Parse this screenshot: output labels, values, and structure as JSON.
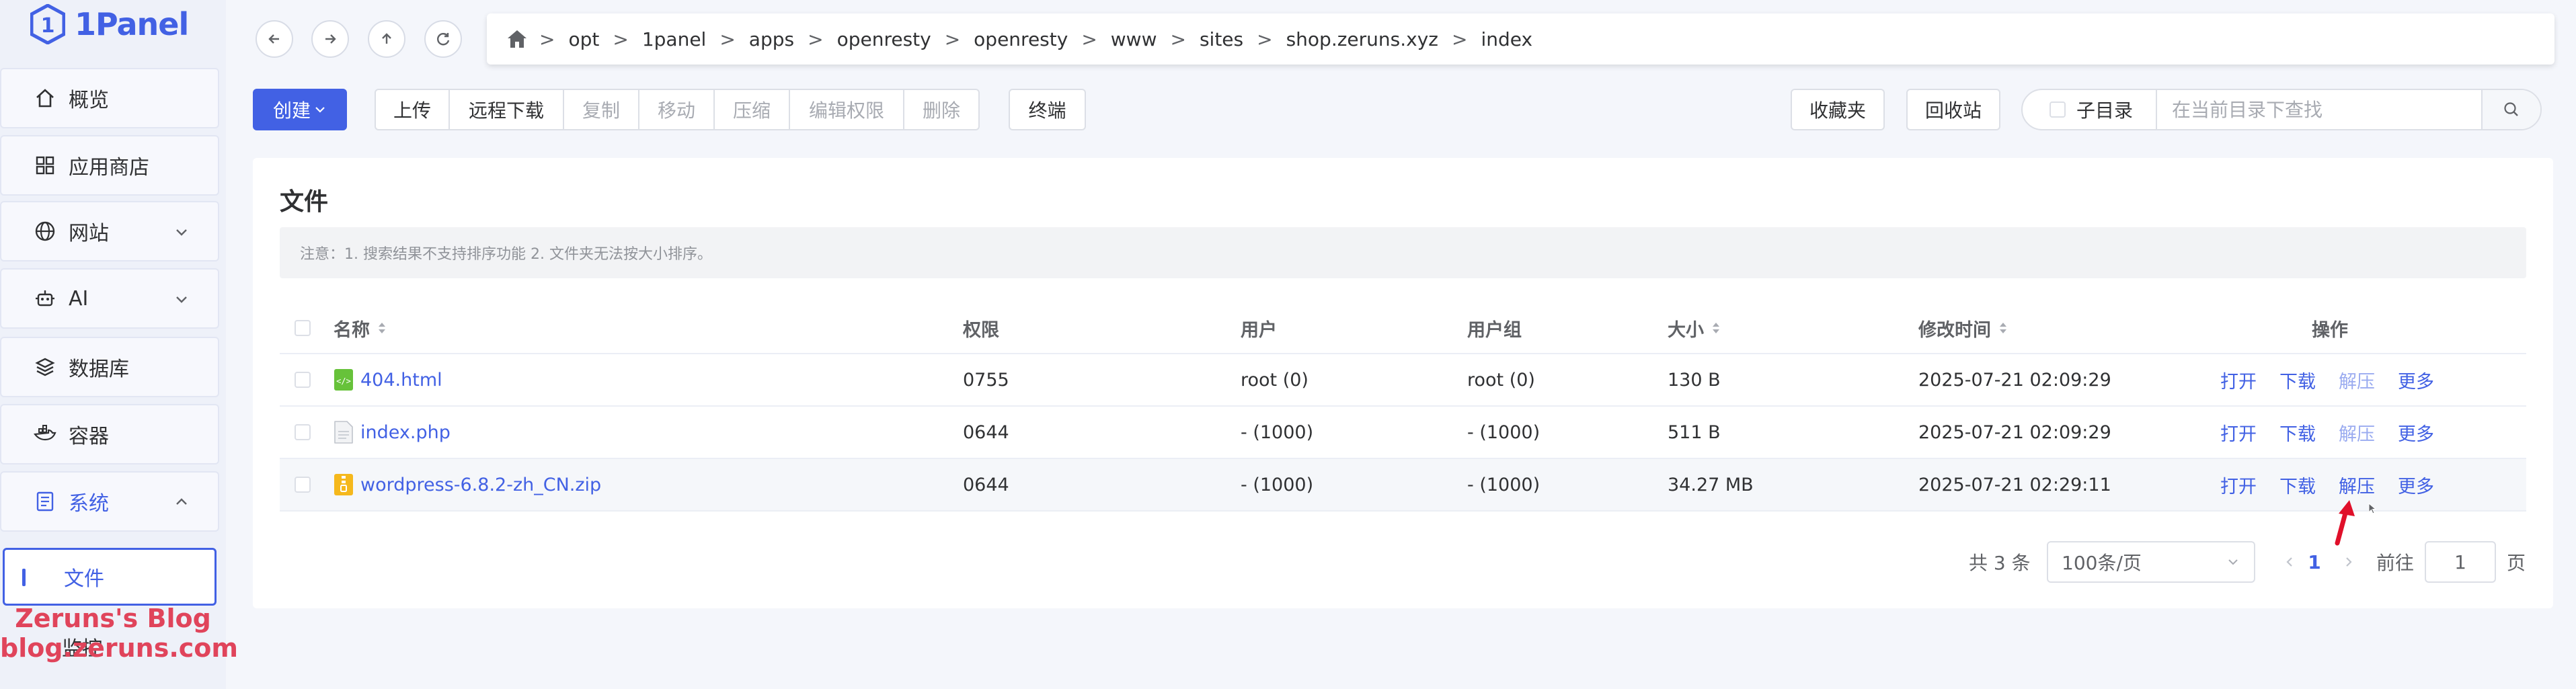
{
  "app": {
    "logo_text": "1Panel",
    "watermark_line1": "Zeruns's Blog",
    "watermark_line2": "blog.zeruns.com"
  },
  "sidebar": {
    "items": [
      {
        "label": "概览",
        "icon": "home-icon"
      },
      {
        "label": "应用商店",
        "icon": "grid-icon"
      },
      {
        "label": "网站",
        "icon": "globe-icon"
      },
      {
        "label": "AI",
        "icon": "robot-icon"
      },
      {
        "label": "数据库",
        "icon": "database-icon"
      },
      {
        "label": "容器",
        "icon": "container-icon"
      },
      {
        "label": "系统",
        "icon": "system-icon"
      }
    ],
    "subitems": [
      {
        "label": "文件"
      },
      {
        "label": "监控"
      }
    ]
  },
  "breadcrumb": {
    "items": [
      "opt",
      "1panel",
      "apps",
      "openresty",
      "openresty",
      "www",
      "sites",
      "shop.zeruns.xyz",
      "index"
    ],
    "separator": ">"
  },
  "toolbar": {
    "create": "创建",
    "upload": "上传",
    "remote_download": "远程下载",
    "copy": "复制",
    "move": "移动",
    "compress": "压缩",
    "edit_permission": "编辑权限",
    "delete": "删除",
    "terminal": "终端",
    "favorites": "收藏夹",
    "recycle_bin": "回收站",
    "subdir_label": "子目录",
    "search_placeholder": "在当前目录下查找"
  },
  "card": {
    "title": "文件",
    "notice": "注意：1. 搜索结果不支持排序功能 2. 文件夹无法按大小排序。"
  },
  "table": {
    "headers": {
      "name": "名称",
      "perm": "权限",
      "user": "用户",
      "group": "用户组",
      "size": "大小",
      "mtime": "修改时间",
      "ops": "操作"
    },
    "rows": [
      {
        "name": "404.html",
        "perm": "0755",
        "user": "root (0)",
        "group": "root (0)",
        "size": "130 B",
        "mtime": "2025-07-21 02:09:29",
        "type": "html"
      },
      {
        "name": "index.php",
        "perm": "0644",
        "user": "- (1000)",
        "group": "- (1000)",
        "size": "511 B",
        "mtime": "2025-07-21 02:09:29",
        "type": "php"
      },
      {
        "name": "wordpress-6.8.2-zh_CN.zip",
        "perm": "0644",
        "user": "- (1000)",
        "group": "- (1000)",
        "size": "34.27 MB",
        "mtime": "2025-07-21 02:29:11",
        "type": "zip"
      }
    ],
    "ops": {
      "open": "打开",
      "download": "下载",
      "extract": "解压",
      "more": "更多"
    }
  },
  "pagination": {
    "total": "共 3 条",
    "page_size": "100条/页",
    "current_page": "1",
    "goto_label": "前往",
    "goto_value": "1",
    "page_suffix": "页"
  },
  "colors": {
    "accent": "#4261e4",
    "watermark": "#e0445b",
    "arrow": "#e0102a"
  }
}
